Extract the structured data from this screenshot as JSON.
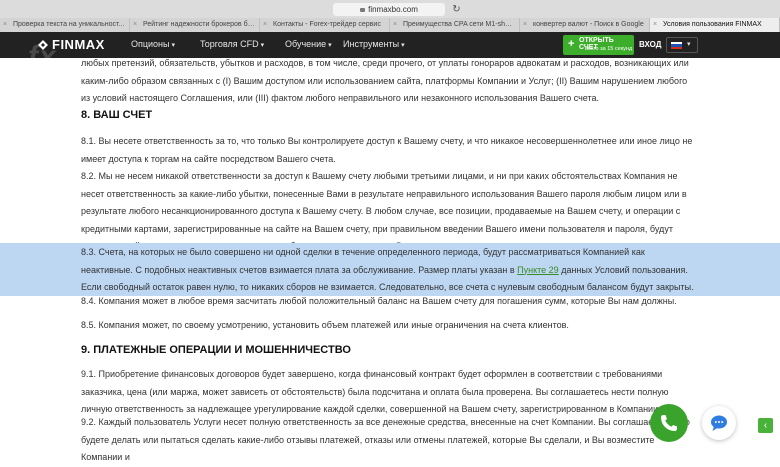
{
  "browser": {
    "url": "finmaxbo.com",
    "tabs": [
      {
        "label": "Проверка текста на уникальност..."
      },
      {
        "label": "Рейтинг надежности брокеров би..."
      },
      {
        "label": "Контакты - Forex-трейдер сервис"
      },
      {
        "label": "Преимущества CPA сети M1-shop..."
      },
      {
        "label": "конвертер валют - Поиск в Google"
      },
      {
        "label": "Условия пользования FINMAX"
      }
    ],
    "active_tab": 5
  },
  "nav": {
    "logo": "FINMAX",
    "watermark": "fx",
    "menu": [
      {
        "label": "Опционы"
      },
      {
        "label": "Торговля CFD"
      },
      {
        "label": "Обучение"
      },
      {
        "label": "Инструменты"
      }
    ],
    "open_account": {
      "line1": "ОТКРЫТЬ СЧЕТ",
      "line2": "всего за 15 секунд"
    },
    "login": "ВХОД",
    "colors": {
      "bar": "#222222",
      "accent": "#3dae2b"
    }
  },
  "content": {
    "p_intro": "любых претензий, обязательств, убытков и расходов, в том числе, среди прочего, от уплаты гонораров адвокатам и расходов, возникающих или каким-либо образом связанных с (I) Вашим доступом или использованием сайта, платформы Компании и Услуг; (II) Вашим нарушением любого из условий настоящего Соглашения, или (III) фактом любого неправильного или незаконного использования Вашего счета.",
    "h8": "8. ВАШ СЧЕТ",
    "p81": "8.1. Вы несете ответственность за то, что только Вы контролируете доступ к Вашему счету, и что никакое несовершеннолетнее или иное лицо не имеет доступа к торгам на сайте посредством Вашего счета.",
    "p82": "8.2. Мы не несем никакой ответственности за доступ к Вашему счету любыми третьими лицами, и ни при каких обстоятельствах Компания не несет ответственность за какие-либо убытки, понесенные Вами в результате неправильного использования Вашего пароля любым лицом или в результате любого несанкционированного доступа к Вашему счету. В любом случае, все позиции, продаваемые на Вашем счету, и операции с кредитными картами, зарегистрированные на сайте на Вашем счету, при правильном введении Вашего имени пользователя и пароля, будут считаться действительными, независимо от того, были они уполномочены Вами или нет.",
    "p83_before": "8.3. Счета, на которых не было совершено ни одной сделки в течение определенного периода, будут рассматриваться Компанией как неактивные. С подобных неактивных счетов взимается плата за обслуживание. Размер платы указан в ",
    "p83_link": "Пункте 29",
    "p83_after": " данных Условий пользования. Если свободный остаток равен нулю, то никаких сборов не взимается. Следовательно, все счета с нулевым свободным балансом будут закрыты.",
    "p84": "8.4. Компания может в любое время засчитать любой положительный баланс на Вашем счету для погашения сумм, которые Вы нам должны.",
    "p85": "8.5. Компания может, по своему усмотрению, установить объем платежей или иные ограничения на счета клиентов.",
    "h9": "9. ПЛАТЕЖНЫЕ ОПЕРАЦИИ И МОШЕННИЧЕСТВО",
    "p91": "9.1. Приобретение финансовых договоров будет завершено, когда финансовый контракт будет оформлен в соответствии с требованиями заказчика, цена (или маржа, может зависеть от обстоятельств) была подсчитана и оплата была проверена. Вы соглашаетесь нести полную личную ответственность за надлежащее урегулирование каждой сделки, совершенной на Вашем счету, зарегистрированном в Компании.",
    "p92": "9.2. Каждый пользователь Услуги несет полную ответственность за все денежные средства, внесенные на счет Компании. Вы соглашаетесь, что будете делать или пытаться сделать какие-либо отзывы платежей, отказы или отмены платежей, которые Вы сделали, и Вы возместите Компании и",
    "highlight_color": "#bdd7f3"
  },
  "widgets": {
    "phone": "phone-icon",
    "chat": "chat-bubble-icon",
    "side": "chevron-left-icon"
  }
}
